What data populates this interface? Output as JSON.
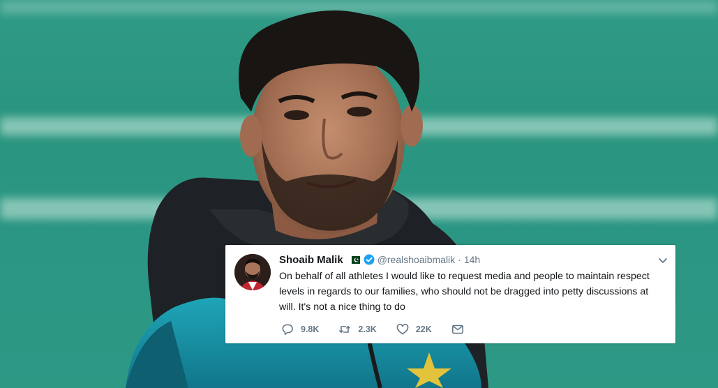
{
  "tweet": {
    "name": "Shoaib Malik",
    "handle": "@realshoaibmalik",
    "separator": "·",
    "time": "14h",
    "text": "On behalf of all athletes I would like to request media and people to  maintain respect levels in regards to our families, who should not be dragged into petty discussions at will. It's not a nice thing to do",
    "replies": "9.8K",
    "retweets": "2.3K",
    "likes": "22K"
  },
  "colors": {
    "background_green": "#2b9683",
    "handle_gray": "#657786",
    "text_dark": "#14171a",
    "verified_blue": "#1da1f2",
    "flag_green": "#01411c"
  },
  "icons": [
    "flag-icon",
    "verified-icon",
    "chevron-down-icon",
    "reply-icon",
    "retweet-icon",
    "like-icon",
    "message-icon"
  ]
}
